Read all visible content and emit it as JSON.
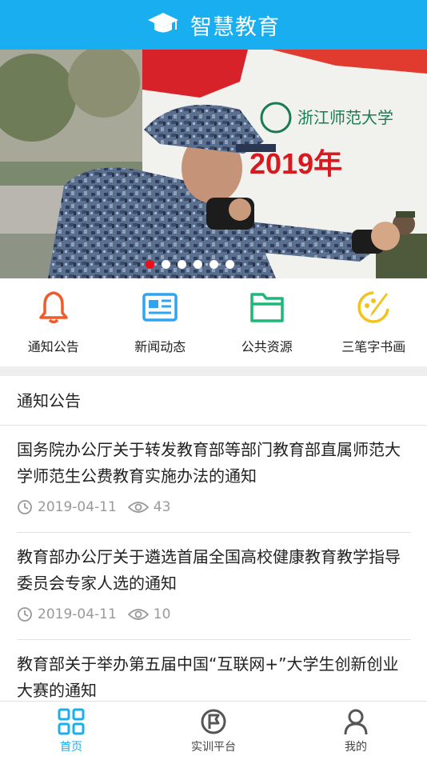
{
  "app": {
    "title": "智慧教育",
    "accent": "#18aef0"
  },
  "banner": {
    "slides": 6,
    "active": 0,
    "text": "浙江师范大学",
    "text2": "2019年"
  },
  "quick_links": [
    {
      "label": "通知公告",
      "icon": "bell-icon",
      "color": "#f25a2a"
    },
    {
      "label": "新闻动态",
      "icon": "news-icon",
      "color": "#2fa4f0"
    },
    {
      "label": "公共资源",
      "icon": "folder-icon",
      "color": "#1fb777"
    },
    {
      "label": "三笔字书画",
      "icon": "brush-icon",
      "color": "#f4c21c"
    }
  ],
  "section": {
    "title": "通知公告"
  },
  "news": [
    {
      "title": "国务院办公厅关于转发教育部等部门教育部直属师范大学师范生公费教育实施办法的通知",
      "date": "2019-04-11",
      "views": "43"
    },
    {
      "title": "教育部办公厅关于遴选首届全国高校健康教育教学指导委员会专家人选的通知",
      "date": "2019-04-11",
      "views": "10"
    },
    {
      "title": "教育部关于举办第五届中国“互联网+”大学生创新创业大赛的通知",
      "date": "",
      "views": ""
    }
  ],
  "tabs": [
    {
      "label": "首页",
      "icon": "home-grid-icon",
      "active": true
    },
    {
      "label": "实训平台",
      "icon": "flag-circle-icon",
      "active": false
    },
    {
      "label": "我的",
      "icon": "user-icon",
      "active": false
    }
  ]
}
